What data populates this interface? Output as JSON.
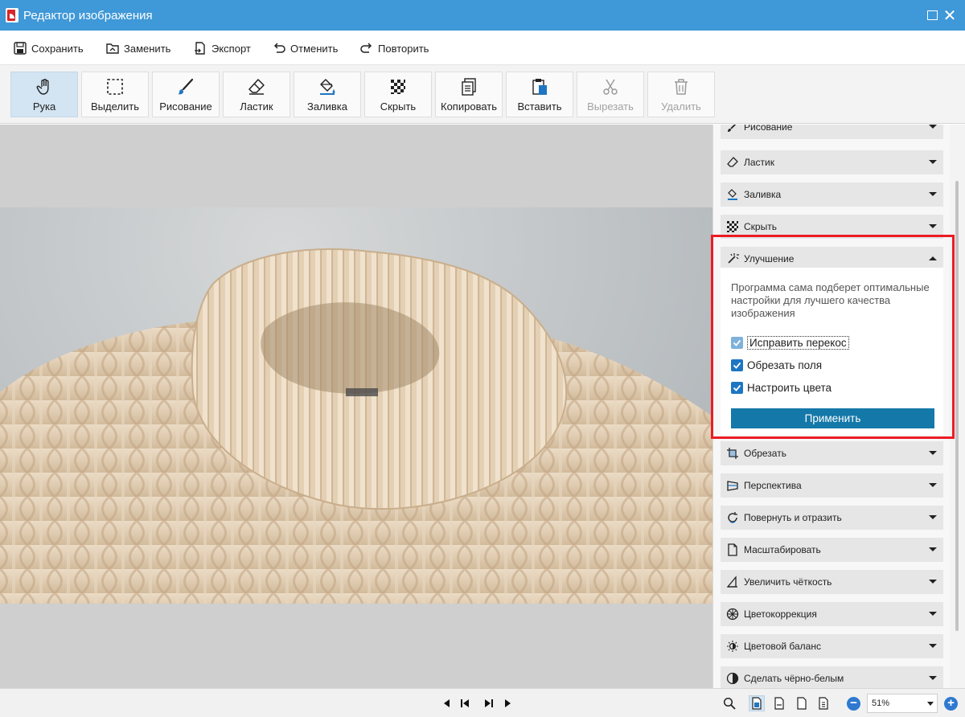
{
  "window": {
    "title": "Редактор изображения"
  },
  "menu": {
    "save": "Сохранить",
    "replace": "Заменить",
    "export": "Экспорт",
    "undo": "Отменить",
    "redo": "Повторить"
  },
  "toolbar": {
    "hand": "Рука",
    "select": "Выделить",
    "draw": "Рисование",
    "eraser": "Ластик",
    "fill": "Заливка",
    "hide": "Скрыть",
    "copy": "Копировать",
    "paste": "Вставить",
    "cut": "Вырезать",
    "delete": "Удалить"
  },
  "panel": {
    "drawing": "Рисование",
    "eraser": "Ластик",
    "fill": "Заливка",
    "hide": "Скрыть",
    "enhance": {
      "title": "Улучшение",
      "description": "Программа сама подберет оптимальные настройки для лучшего качества изображения",
      "options": [
        {
          "label": "Исправить перекос",
          "checked": true
        },
        {
          "label": "Обрезать поля",
          "checked": true
        },
        {
          "label": "Настроить цвета",
          "checked": true
        }
      ],
      "apply": "Применить"
    },
    "crop": "Обрезать",
    "perspective": "Перспектива",
    "rotate": "Повернуть и отразить",
    "scale": "Масштабировать",
    "sharpen": "Увеличить чёткость",
    "color_correction": "Цветокоррекция",
    "color_balance": "Цветовой баланс",
    "bw": "Сделать чёрно-белым"
  },
  "status": {
    "zoom": "51%"
  },
  "colors": {
    "titlebar": "#3f98d7",
    "accent": "#1478a8",
    "highlight": "#ec1c24",
    "checkbox": "#1e76c2"
  },
  "icons": [
    "app-logo-icon",
    "save-icon",
    "replace-icon",
    "export-icon",
    "undo-icon",
    "redo-icon",
    "hand-icon",
    "select-icon",
    "brush-icon",
    "eraser-icon",
    "fill-icon",
    "checker-icon",
    "copy-icon",
    "paste-icon",
    "scissors-icon",
    "trash-icon",
    "magic-wand-icon",
    "crop-icon",
    "perspective-icon",
    "rotate-icon",
    "scale-icon",
    "sharpen-icon",
    "color-wheel-icon",
    "brightness-icon",
    "bw-icon",
    "search-icon",
    "zoom-out-icon",
    "zoom-in-icon"
  ]
}
